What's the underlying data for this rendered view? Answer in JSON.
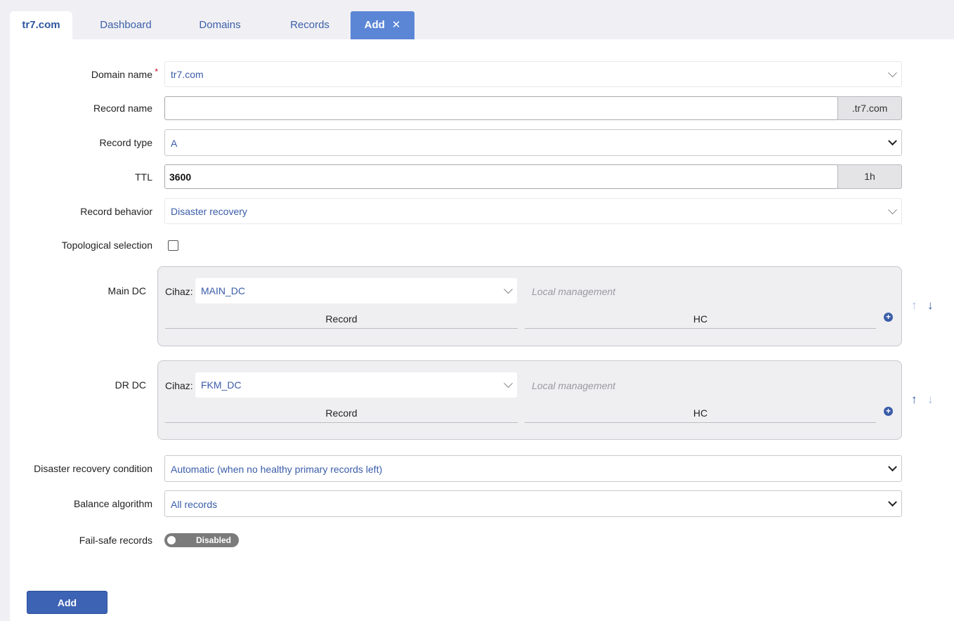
{
  "tabs": {
    "domain": "tr7.com",
    "dashboard": "Dashboard",
    "domains": "Domains",
    "records": "Records",
    "add": "Add",
    "close_glyph": "✕"
  },
  "form": {
    "domain_name": {
      "label": "Domain name",
      "required_mark": "*",
      "value": "tr7.com"
    },
    "record_name": {
      "label": "Record name",
      "value": "",
      "suffix": ".tr7.com"
    },
    "record_type": {
      "label": "Record type",
      "value": "A"
    },
    "ttl": {
      "label": "TTL",
      "value": "3600",
      "suffix": "1h"
    },
    "record_behavior": {
      "label": "Record behavior",
      "value": "Disaster recovery"
    },
    "topological_selection": {
      "label": "Topological selection",
      "checked": false
    },
    "dcs": [
      {
        "label": "Main DC",
        "device_label": "Cihaz:",
        "device_value": "MAIN_DC",
        "local_management": "Local management",
        "col_record": "Record",
        "col_hc": "HC"
      },
      {
        "label": "DR DC",
        "device_label": "Cihaz:",
        "device_value": "FKM_DC",
        "local_management": "Local management",
        "col_record": "Record",
        "col_hc": "HC"
      }
    ],
    "dr_condition": {
      "label": "Disaster recovery condition",
      "value": "Automatic (when no healthy primary records left)"
    },
    "balance_algorithm": {
      "label": "Balance algorithm",
      "value": "All records"
    },
    "fail_safe": {
      "label": "Fail-safe records",
      "state": "Disabled"
    }
  },
  "submit_label": "Add",
  "icons": {
    "plus": "+",
    "up": "↑",
    "down": "↓"
  },
  "colors": {
    "accent": "#3d63b5",
    "link": "#3a5ca8",
    "tab_add": "#5b86d6"
  }
}
